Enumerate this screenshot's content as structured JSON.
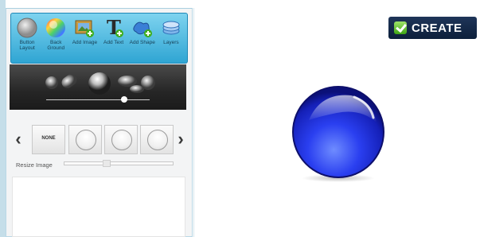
{
  "toolbar": {
    "items": [
      {
        "label": "Button Layout",
        "icon": "button-layout-icon"
      },
      {
        "label": "Back Ground",
        "icon": "background-color-icon"
      },
      {
        "label": "Add Image",
        "icon": "add-image-icon"
      },
      {
        "label": "Add Text",
        "icon": "add-text-icon"
      },
      {
        "label": "Add Shape",
        "icon": "add-shape-icon"
      },
      {
        "label": "Layers",
        "icon": "layers-icon"
      }
    ]
  },
  "shapes": {
    "slider_value": 0.75
  },
  "carousel": {
    "none_label": "NONE",
    "prev": "‹",
    "next": "›"
  },
  "resize": {
    "label": "Resize Image"
  },
  "create": {
    "label": "CREATE"
  },
  "colors": {
    "toolbar": "#2fa5d3",
    "create_bg": "#12284a",
    "orb": "#1b2fd6"
  }
}
